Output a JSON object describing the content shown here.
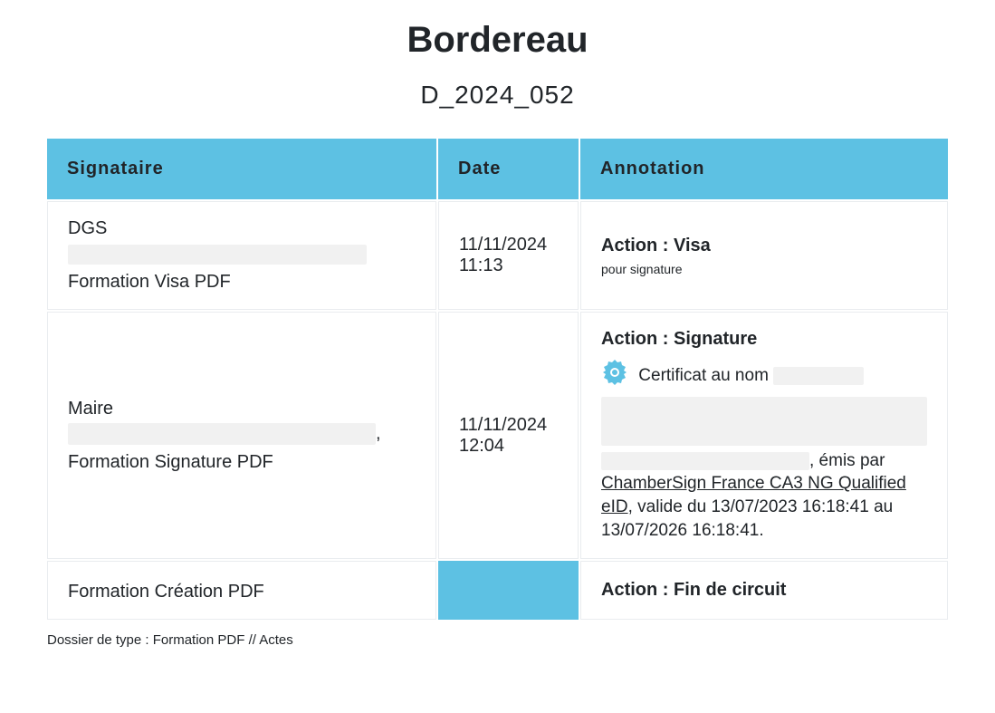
{
  "title": "Bordereau",
  "subtitle": "D_2024_052",
  "headers": {
    "signataire": "Signataire",
    "date": "Date",
    "annotation": "Annotation"
  },
  "rows": [
    {
      "role": "DGS",
      "sub": "Formation Visa PDF",
      "date": "11/11/2024",
      "time": "11:13",
      "action_prefix": "Action : ",
      "action_name": "Visa",
      "note": "pour signature"
    },
    {
      "role": "Maire",
      "role_suffix": ",",
      "sub": "Formation Signature PDF",
      "date": "11/11/2024",
      "time": "12:04",
      "action_prefix": "Action : ",
      "action_name": "Signature",
      "cert_intro": "Certificat au nom",
      "cert_issued_by": ", émis par ",
      "cert_authority": "ChamberSign France CA3 NG Qualified eID",
      "cert_validity": ", valide du 13/07/2023 16:18:41 au 13/07/2026 16:18:41."
    },
    {
      "sub_only": "Formation Création PDF",
      "action_prefix": "Action : ",
      "action_name": "Fin de circuit"
    }
  ],
  "footer": "Dossier de type : Formation PDF // Actes"
}
